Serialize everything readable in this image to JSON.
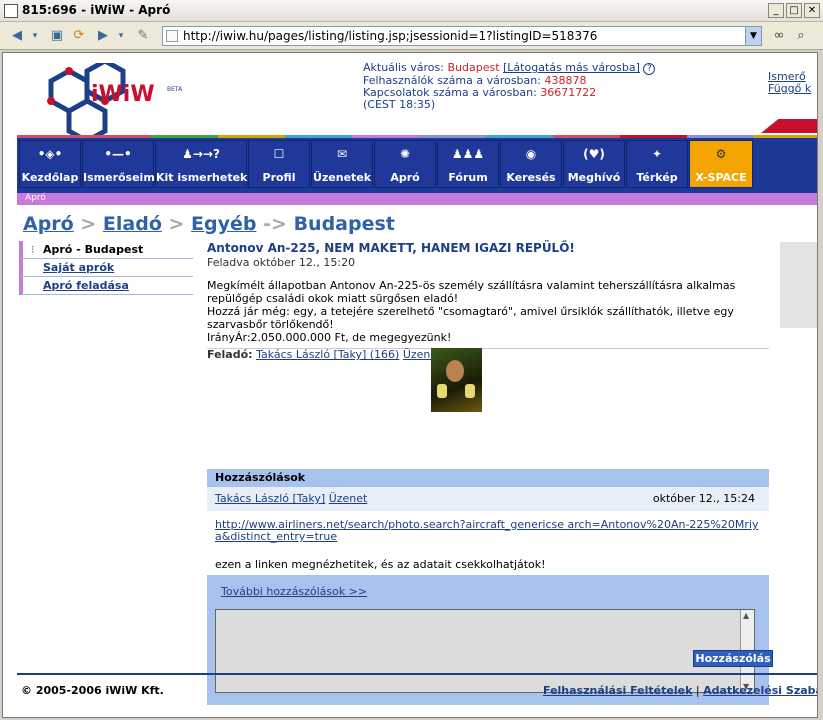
{
  "window": {
    "title": "815:696 - iWiW - Apró",
    "address": "http://iwiw.hu/pages/listing/listing.jsp;jsessionid=1?listingID=518376"
  },
  "header": {
    "logo_text": "iWiW",
    "logo_badge": "BETA",
    "current_city_label": "Aktuális város:",
    "current_city": "Budapest",
    "other_city_link": "[Látogatás más városba]",
    "help_icon": "?",
    "users_label": "Felhasználók száma a városban:",
    "users_count": "438878",
    "connections_label": "Kapcsolatok száma a városban:",
    "connections_count": "36671722",
    "time": "(CEST 18:35)",
    "right_links": [
      "Ismerő",
      "Függő k"
    ]
  },
  "nav": {
    "items": [
      {
        "label": "Kezdőlap",
        "icon": "•◈•"
      },
      {
        "label": "Ismerőseim",
        "icon": "•—•"
      },
      {
        "label": "Kit ismerhetek?",
        "icon": "♟→→?"
      },
      {
        "label": "Profil",
        "icon": "☐"
      },
      {
        "label": "Üzenetek",
        "icon": "✉"
      },
      {
        "label": "Apró",
        "icon": "✺"
      },
      {
        "label": "Fórum",
        "icon": "♟♟♟"
      },
      {
        "label": "Keresés",
        "icon": "◉"
      },
      {
        "label": "Meghívó",
        "icon": "(♥)"
      },
      {
        "label": "Térkép",
        "icon": "✦"
      },
      {
        "label": "X-SPACE",
        "icon": "⚙"
      }
    ],
    "sub_label": "Apró"
  },
  "breadcrumb": {
    "parts": [
      "Apró",
      "Eladó",
      "Egyéb",
      "Budapest"
    ],
    "separators": [
      ">",
      ">",
      "->"
    ]
  },
  "leftmenu": {
    "items": [
      "Apró - Budapest",
      "Saját aprók",
      "Apró feladása"
    ]
  },
  "listing": {
    "title": "Antonov An-225, NEM MAKETT, HANEM IGAZI REPÜLŐ!",
    "posted": "Feladva október 12., 15:20",
    "description": [
      "Megkímélt állapotban Antonov An-225-ös személy szállításra valamint teherszállításra alkalmas repülőgép családi okok miatt sürgősen eladó!",
      "Hozzá jár még: egy, a tetejére szerelhető \"csomagtaró\", amivel űrsiklók szállíthatók, illetve egy szarvasbőr törlőkendő!",
      "IrányÁr:2.050.000.000 Ft, de megegyezünk!"
    ],
    "poster_label": "Feladó:",
    "poster_name": "Takács László [Taky] (166)",
    "poster_message": "Üzenet"
  },
  "comments": {
    "header": "Hozzászólások",
    "author": "Takács László [Taky]",
    "message_link": "Üzenet",
    "date": "október 12., 15:24",
    "link": "http://www.airliners.net/search/photo.search?aircraft_genericse arch=Antonov%20An-225%20Mriya&distinct_entry=true",
    "text": "ezen a linken megnézhetitek, és az adatait csekkolhatjátok!",
    "more_link": "További hozzászólások >>",
    "submit": "Hozzászólás"
  },
  "footer": {
    "copyright": "© 2005-2006 iWiW Kft.",
    "terms": "Felhasználási Feltételek",
    "privacy": "Adatkezelési Szabályzat",
    "separator": "|"
  },
  "colors": {
    "nav_blue": "#1d3997",
    "accent_purple": "#c77ad9",
    "link_blue": "#1d3f86",
    "highlight_red": "#d0202e",
    "panel_blue": "#a8c2ee"
  }
}
